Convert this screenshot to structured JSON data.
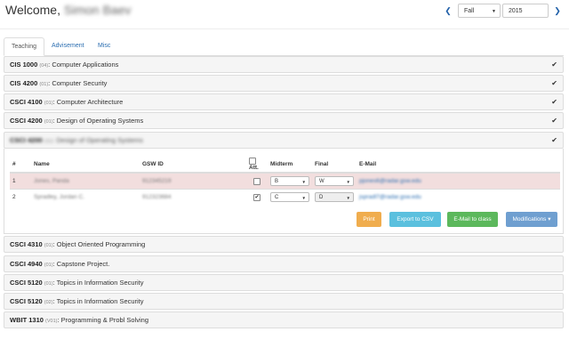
{
  "header": {
    "welcome": "Welcome,",
    "user_name": "Simon Baev",
    "term": "Fall",
    "year": "2015"
  },
  "tabs": [
    "Teaching",
    "Advisement",
    "Misc"
  ],
  "courses_before": [
    {
      "code": "CIS 1000",
      "section": "(04)",
      "title": ": Computer Applications",
      "check": "✔"
    },
    {
      "code": "CIS 4200",
      "section": "(01)",
      "title": ": Computer Security",
      "check": "✔"
    },
    {
      "code": "CSCI 4100",
      "section": "(01)",
      "title": ": Computer Architecture",
      "check": "✔"
    },
    {
      "code": "CSCI 4200",
      "section": "(01)",
      "title": ": Design of Operating Systems",
      "check": "✔"
    }
  ],
  "expanded_course": {
    "code": "CSCI 4200",
    "section": "(11)",
    "title": ": Design of Operating Systems",
    "check": "✔"
  },
  "roster": {
    "headers": [
      "#",
      "Name",
      "GSW ID",
      "Att.",
      "Midterm",
      "Final",
      "E-Mail"
    ],
    "rows": [
      {
        "num": "1",
        "name": "Jones, Panda",
        "id": "912345219",
        "attended": false,
        "midterm": "B",
        "final": "W",
        "email": "pjones6@radar.gsw.edu"
      },
      {
        "num": "2",
        "name": "Spradley, Jordan C.",
        "id": "912323684",
        "attended": true,
        "midterm": "C",
        "final": "D",
        "email": "jspradl7@radar.gsw.edu"
      }
    ],
    "check_mark": "✔"
  },
  "actions": {
    "print": "Print",
    "export": "Export to CSV",
    "email": "E-Mail to class",
    "modifications": "Modifications ▾"
  },
  "courses_after": [
    {
      "code": "CSCI 4310",
      "section": "(01)",
      "title": ": Object Oriented Programming"
    },
    {
      "code": "CSCI 4940",
      "section": "(01)",
      "title": ": Capstone Project."
    },
    {
      "code": "CSCI 5120",
      "section": "(01)",
      "title": ": Topics in Information Security"
    },
    {
      "code": "CSCI 5120",
      "section": "(02)",
      "title": ": Topics in Information Security"
    },
    {
      "code": "WBIT 1310",
      "section": "(V01)",
      "title": ": Programming & Probl Solving"
    }
  ],
  "colors": {
    "print": "#f0ad4e",
    "export": "#5bc0de",
    "email": "#5cb85c",
    "modifications": "#6f9fd0",
    "danger_row": "#f2dede"
  }
}
